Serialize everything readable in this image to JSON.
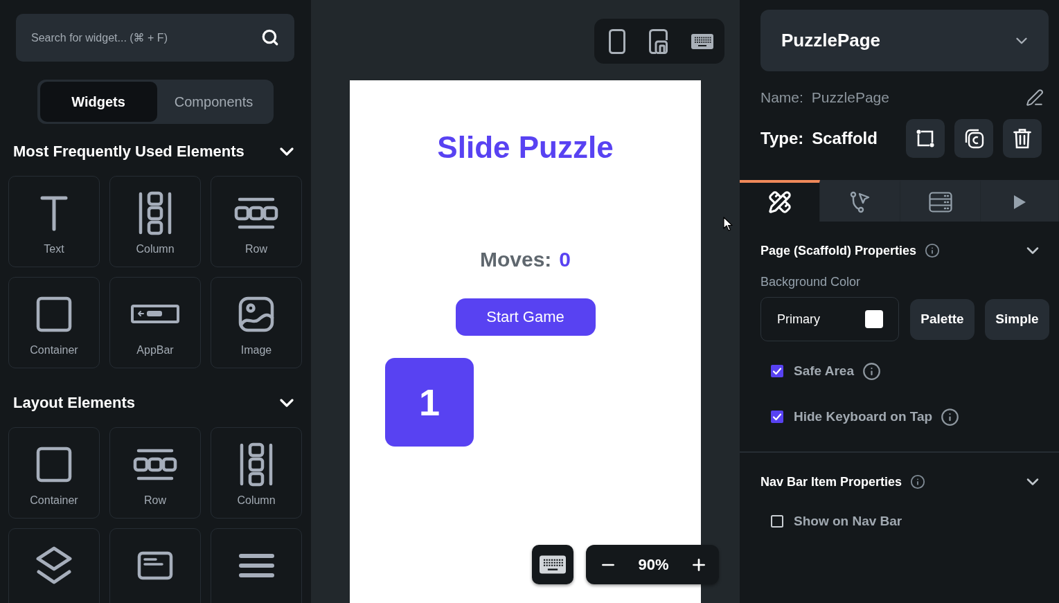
{
  "sidebar": {
    "search": {
      "placeholder": "Search for widget... (⌘ + F)"
    },
    "tabs": [
      {
        "label": "Widgets",
        "selected": true
      },
      {
        "label": "Components",
        "selected": false
      }
    ],
    "sections": [
      {
        "title": "Most Frequently Used Elements",
        "expanded": true,
        "items": [
          {
            "kind": "text",
            "label": "Text"
          },
          {
            "kind": "column",
            "label": "Column"
          },
          {
            "kind": "row",
            "label": "Row"
          },
          {
            "kind": "container",
            "label": "Container"
          },
          {
            "kind": "appbar",
            "label": "AppBar"
          },
          {
            "kind": "image",
            "label": "Image"
          }
        ]
      },
      {
        "title": "Layout Elements",
        "expanded": true,
        "items": [
          {
            "kind": "container",
            "label": "Container"
          },
          {
            "kind": "row",
            "label": "Row"
          },
          {
            "kind": "column",
            "label": "Column"
          },
          {
            "kind": "stack"
          },
          {
            "kind": "card"
          },
          {
            "kind": "list"
          }
        ]
      }
    ]
  },
  "canvas": {
    "preview": {
      "title": "Slide Puzzle",
      "moves_label": "Moves:",
      "moves_value": "0",
      "start_button": "Start Game",
      "tiles": [
        "1"
      ]
    },
    "zoom": {
      "value": "90%"
    }
  },
  "properties": {
    "page_selector": {
      "value": "PuzzlePage"
    },
    "name": {
      "label": "Name:",
      "value": "PuzzlePage"
    },
    "type": {
      "label": "Type:",
      "value": "Scaffold"
    },
    "tabs": [
      {
        "selected": true
      },
      {
        "selected": false
      },
      {
        "selected": false
      },
      {
        "selected": false
      }
    ],
    "sections": [
      {
        "title": "Page (Scaffold) Properties",
        "info": true,
        "expanded": true,
        "background_color": {
          "label": "Background Color",
          "value": "Primary",
          "color": "#ffffff",
          "buttons": [
            "Palette",
            "Simple"
          ]
        },
        "options": [
          {
            "label": "Safe Area",
            "checked": true,
            "info": true
          },
          {
            "label": "Hide Keyboard on Tap",
            "checked": true,
            "info": true
          }
        ]
      },
      {
        "title": "Nav Bar Item Properties",
        "info": true,
        "expanded": true,
        "options": [
          {
            "label": "Show on Nav Bar",
            "checked": false,
            "info": false
          }
        ]
      }
    ]
  }
}
